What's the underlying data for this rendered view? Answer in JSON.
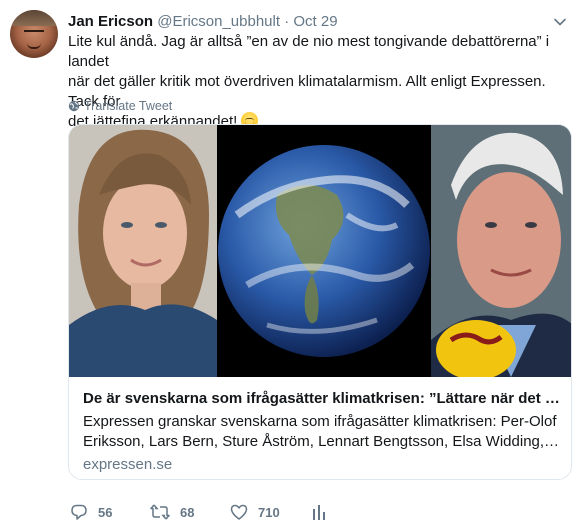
{
  "author": {
    "name": "Jan Ericson",
    "handle": "@Ericson_ubbhult",
    "separator": "·",
    "date": "Oct 29"
  },
  "tweet": {
    "lines": [
      "Lite kul ändå. Jag är alltså ”en av de nio mest tongivande debattörerna” i landet",
      "när det gäller kritik mot överdriven klimatalarmism. Allt enligt Expressen. Tack för",
      "det jättefina erkännandet!"
    ],
    "emoji": "smiling-face-emoji"
  },
  "translate_label": "Translate Tweet",
  "card": {
    "title": "De är svenskarna som ifrågasätter klimatkrisen: ”Lättare när det är v...",
    "description_lines": [
      "Expressen granskar svenskarna som ifrågasätter klimatkrisen: Per-Olof",
      "Eriksson, Lars Bern, Sture Åström, Lennart Bengtsson, Elsa Widding, Jan ..."
    ],
    "domain": "expressen.se"
  },
  "actions": {
    "replies": "56",
    "retweets": "68",
    "likes": "710"
  },
  "colors": {
    "text": "#14171a",
    "muted": "#657786",
    "border": "#e1e8ed"
  }
}
